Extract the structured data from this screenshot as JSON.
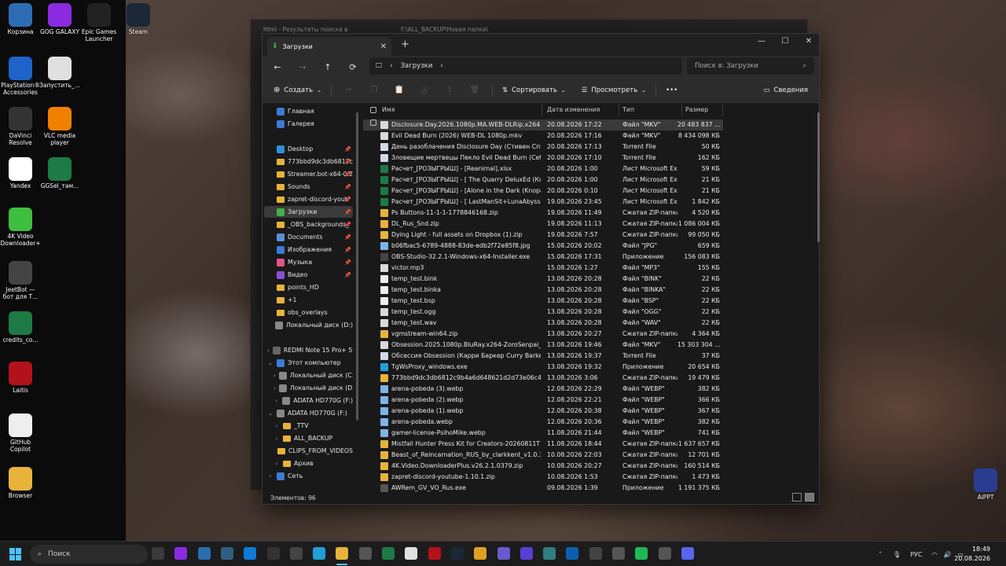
{
  "desktop_icons": [
    {
      "label": "Корзина",
      "icon": "recycle-bin-icon",
      "color": "#2d6db5"
    },
    {
      "label": "GOG GALAXY",
      "icon": "gog-galaxy-icon",
      "color": "#8a2be2"
    },
    {
      "label": "Epic Games Launcher",
      "icon": "epic-games-icon",
      "color": "#222222"
    },
    {
      "label": "Steam",
      "icon": "steam-icon",
      "color": "#1b2838"
    },
    {
      "label": "PlayStation® Accessories",
      "icon": "playstation-icon",
      "color": "#1e63c9"
    },
    {
      "label": "Запустить_...",
      "icon": "launch-icon",
      "color": "#e0e0e0"
    },
    {
      "label": "DaVinci Resolve",
      "icon": "davinci-icon",
      "color": "#333333"
    },
    {
      "label": "VLC media player",
      "icon": "vlc-icon",
      "color": "#f08000"
    },
    {
      "label": "Yandex",
      "icon": "yandex-icon",
      "color": "#ffffff"
    },
    {
      "label": "GGSel_там...",
      "icon": "excel-file-icon",
      "color": "#1d7a45"
    },
    {
      "label": "4K Video Downloader+",
      "icon": "4k-downloader-icon",
      "color": "#3fbf3f"
    },
    {
      "label": "JeetBot — бот для Т...",
      "icon": "jeetbot-icon",
      "color": "#444444"
    },
    {
      "label": "credits_co...",
      "icon": "excel-file-icon",
      "color": "#1d7a45"
    },
    {
      "label": "Laitis",
      "icon": "laitis-icon",
      "color": "#b3121c"
    },
    {
      "label": "GitHub Copilot",
      "icon": "github-copilot-icon",
      "color": "#eeeeee"
    },
    {
      "label": "Browser",
      "icon": "browser-folder-icon",
      "color": "#e8b33a"
    },
    {
      "label": "AiPPT",
      "icon": "aippt-icon",
      "color": "#2a3c90"
    }
  ],
  "background_window": {
    "tab1": "html - Результаты поиска в",
    "tab2": "F:\\ALL_BACKUP\\Новая папка\\"
  },
  "window": {
    "tab_title": "Загрузки",
    "address": "Загрузки",
    "search_placeholder": "Поиск в: Загрузки",
    "toolbar": {
      "create": "Создать",
      "sort": "Сортировать",
      "view": "Просмотреть",
      "more": "•••",
      "details": "Сведения"
    },
    "columns": {
      "name": "Имя",
      "date": "Дата изменения",
      "type": "Тип",
      "size": "Размер"
    },
    "status": "Элементов: 96",
    "nav": [
      {
        "label": "Главная",
        "icon": "home-icon",
        "indent": 0,
        "chev": "",
        "pin": false
      },
      {
        "label": "Галерея",
        "icon": "gallery-icon",
        "indent": 0,
        "chev": "",
        "pin": false
      },
      {
        "label": "Desktop",
        "icon": "desktop-icon",
        "indent": 0,
        "chev": "",
        "pin": true
      },
      {
        "label": "773bbd9dc3db6812c",
        "icon": "folder-icon",
        "indent": 0,
        "chev": "",
        "pin": true
      },
      {
        "label": "Streamer.bot-x64-0.2",
        "icon": "folder-icon",
        "indent": 0,
        "chev": "",
        "pin": true
      },
      {
        "label": "Sounds",
        "icon": "folder-icon",
        "indent": 0,
        "chev": "",
        "pin": true
      },
      {
        "label": "zapret-discord-yout",
        "icon": "folder-icon",
        "indent": 0,
        "chev": "",
        "pin": true
      },
      {
        "label": "Загрузки",
        "icon": "downloads-icon",
        "indent": 0,
        "chev": "",
        "pin": true,
        "selected": true
      },
      {
        "label": "_OBS_backgrounds_",
        "icon": "folder-icon",
        "indent": 0,
        "chev": "",
        "pin": true
      },
      {
        "label": "Documents",
        "icon": "documents-icon",
        "indent": 0,
        "chev": "",
        "pin": true
      },
      {
        "label": "Изображения",
        "icon": "pictures-icon",
        "indent": 0,
        "chev": "",
        "pin": true
      },
      {
        "label": "Музыка",
        "icon": "music-icon",
        "indent": 0,
        "chev": "",
        "pin": true
      },
      {
        "label": "Видео",
        "icon": "video-icon",
        "indent": 0,
        "chev": "",
        "pin": true
      },
      {
        "label": "points_HD",
        "icon": "folder-icon",
        "indent": 0,
        "chev": "",
        "pin": false
      },
      {
        "label": "+1",
        "icon": "folder-icon",
        "indent": 0,
        "chev": "",
        "pin": false
      },
      {
        "label": "obs_overlays",
        "icon": "folder-icon",
        "indent": 0,
        "chev": "",
        "pin": false
      },
      {
        "label": "Локальный диск (D:)",
        "icon": "drive-icon",
        "indent": 0,
        "chev": "",
        "pin": false
      },
      {
        "label": "REDMI Note 15 Pro+ 5G",
        "icon": "phone-icon",
        "indent": 0,
        "chev": "›",
        "pin": false
      },
      {
        "label": "Этот компьютер",
        "icon": "computer-icon",
        "indent": 0,
        "chev": "⌄",
        "pin": false
      },
      {
        "label": "Локальный диск (C:)",
        "icon": "drive-icon",
        "indent": 1,
        "chev": "›",
        "pin": false
      },
      {
        "label": "Локальный диск (D:)",
        "icon": "drive-icon",
        "indent": 1,
        "chev": "›",
        "pin": false
      },
      {
        "label": "ADATA HD770G (F:)",
        "icon": "drive-icon",
        "indent": 1,
        "chev": "›",
        "pin": false
      },
      {
        "label": "ADATA HD770G (F:)",
        "icon": "drive-icon",
        "indent": 0,
        "chev": "⌄",
        "pin": false
      },
      {
        "label": "_TTV",
        "icon": "folder-icon",
        "indent": 1,
        "chev": "›",
        "pin": false
      },
      {
        "label": "ALL_BACKUP",
        "icon": "folder-icon",
        "indent": 1,
        "chev": "›",
        "pin": false
      },
      {
        "label": "CLIPS_FROM_VIDEOS",
        "icon": "folder-icon",
        "indent": 1,
        "chev": "",
        "pin": false
      },
      {
        "label": "Архив",
        "icon": "folder-icon",
        "indent": 1,
        "chev": "›",
        "pin": false
      },
      {
        "label": "Сеть",
        "icon": "network-icon",
        "indent": 0,
        "chev": "›",
        "pin": false
      }
    ],
    "files": [
      {
        "name": "Disclosure.Day.2026.1080p.MA.WEB-DLRip.x264-HiD...",
        "date": "20.08.2026 17:22",
        "type": "Файл \"MKV\"",
        "size": "20 483 837 ...",
        "icon": "video-file-icon",
        "selected": true
      },
      {
        "name": "Evil Dead Burn (2026) WEB-DL 1080p.mkv",
        "date": "20.08.2026 17:16",
        "type": "Файл \"MKV\"",
        "size": "8 434 098 КБ",
        "icon": "video-file-icon"
      },
      {
        "name": "День разоблачения Disclosure Day (Стивен Спилб...",
        "date": "20.08.2026 17:13",
        "type": "Torrent File",
        "size": "50 КБ",
        "icon": "torrent-file-icon"
      },
      {
        "name": "Зловещие мертвецы Пекло Evil Dead Burn (Себас...",
        "date": "20.08.2026 17:10",
        "type": "Torrent File",
        "size": "162 КБ",
        "icon": "torrent-file-icon"
      },
      {
        "name": "Расчет_[РОЗЫГРЫШ] - [Reanimal].xlsx",
        "date": "20.08.2026 1:00",
        "type": "Лист Microsoft Ex...",
        "size": "59 КБ",
        "icon": "excel-file-icon"
      },
      {
        "name": "Расчет_[РОЗЫГРЫШ] - [ The Quarry DeluxEd (Кнор...",
        "date": "20.08.2026 1:00",
        "type": "Лист Microsoft Ex...",
        "size": "21 КБ",
        "icon": "excel-file-icon"
      },
      {
        "name": "Расчет_[РОЗЫГРЫШ] - [Alone in the Dark (KnopaFil...",
        "date": "20.08.2026 0:10",
        "type": "Лист Microsoft Ex...",
        "size": "21 КБ",
        "icon": "excel-file-icon"
      },
      {
        "name": "Расчет_[РОЗЫГРЫШ] - [ LastManSit+LunaAbyss+C...",
        "date": "19.08.2026 23:45",
        "type": "Лист Microsoft Ex...",
        "size": "1 842 КБ",
        "icon": "excel-file-icon"
      },
      {
        "name": "Ps Buttons-11-1-1-1778846168.zip",
        "date": "19.08.2026 11:49",
        "type": "Сжатая ZIP-папка",
        "size": "4 520 КБ",
        "icon": "zip-folder-icon"
      },
      {
        "name": "DL_Rus_Snd.zip",
        "date": "19.08.2026 11:13",
        "type": "Сжатая ZIP-папка",
        "size": "1 086 004 КБ",
        "icon": "zip-folder-icon"
      },
      {
        "name": "Dying Light - full assets on Dropbox (1).zip",
        "date": "19.08.2026 7:57",
        "type": "Сжатая ZIP-папка",
        "size": "99 050 КБ",
        "icon": "zip-folder-icon"
      },
      {
        "name": "b06fbac5-6789-4888-83de-edb2f72e85f8.jpg",
        "date": "15.08.2026 20:02",
        "type": "Файл \"JPG\"",
        "size": "659 КБ",
        "icon": "image-file-icon"
      },
      {
        "name": "OBS-Studio-32.2.1-Windows-x64-Installer.exe",
        "date": "15.08.2026 17:31",
        "type": "Приложение",
        "size": "156 083 КБ",
        "icon": "obs-app-icon"
      },
      {
        "name": "victor.mp3",
        "date": "15.08.2026 1:27",
        "type": "Файл \"MP3\"",
        "size": "155 КБ",
        "icon": "audio-file-icon"
      },
      {
        "name": "temp_test.bink",
        "date": "13.08.2026 20:28",
        "type": "Файл \"BINK\"",
        "size": "22 КБ",
        "icon": "generic-file-icon"
      },
      {
        "name": "temp_test.binka",
        "date": "13.08.2026 20:28",
        "type": "Файл \"BINKA\"",
        "size": "22 КБ",
        "icon": "generic-file-icon"
      },
      {
        "name": "temp_test.bsp",
        "date": "13.08.2026 20:28",
        "type": "Файл \"BSP\"",
        "size": "22 КБ",
        "icon": "generic-file-icon"
      },
      {
        "name": "temp_test.ogg",
        "date": "13.08.2026 20:28",
        "type": "Файл \"OGG\"",
        "size": "22 КБ",
        "icon": "audio-file-icon"
      },
      {
        "name": "temp_test.wav",
        "date": "13.08.2026 20:28",
        "type": "Файл \"WAV\"",
        "size": "22 КБ",
        "icon": "audio-file-icon"
      },
      {
        "name": "vgmstream-win64.zip",
        "date": "13.08.2026 20:27",
        "type": "Сжатая ZIP-папка",
        "size": "4 364 КБ",
        "icon": "zip-folder-icon"
      },
      {
        "name": "Obsession.2025.1080p.BluRay.x264-ZoroSenpai_Enia...",
        "date": "13.08.2026 19:46",
        "type": "Файл \"MKV\"",
        "size": "15 303 304 ...",
        "icon": "video-file-icon"
      },
      {
        "name": "Обсессия Obsession (Карри Баркер Curry Barker) [...",
        "date": "13.08.2026 19:37",
        "type": "Torrent File",
        "size": "37 КБ",
        "icon": "torrent-file-icon"
      },
      {
        "name": "TgWsProxy_windows.exe",
        "date": "13.08.2026 19:32",
        "type": "Приложение",
        "size": "20 654 КБ",
        "icon": "telegram-app-icon"
      },
      {
        "name": "773bbd9dc3db6812c9b4a6d648621d2d73e06c4d.zip",
        "date": "13.08.2026 3:06",
        "type": "Сжатая ZIP-папка",
        "size": "19 479 КБ",
        "icon": "zip-folder-icon"
      },
      {
        "name": "arena-pobeda (3).webp",
        "date": "12.08.2026 22:29",
        "type": "Файл \"WEBP\"",
        "size": "382 КБ",
        "icon": "image-file-icon"
      },
      {
        "name": "arena-pobeda (2).webp",
        "date": "12.08.2026 22:21",
        "type": "Файл \"WEBP\"",
        "size": "366 КБ",
        "icon": "image-file-icon"
      },
      {
        "name": "arena-pobeda (1).webp",
        "date": "12.08.2026 20:38",
        "type": "Файл \"WEBP\"",
        "size": "367 КБ",
        "icon": "image-file-icon"
      },
      {
        "name": "arena-pobeda.webp",
        "date": "12.08.2026 20:36",
        "type": "Файл \"WEBP\"",
        "size": "382 КБ",
        "icon": "image-file-icon"
      },
      {
        "name": "gamer-license-PsihoMike.webp",
        "date": "11.08.2026 21:44",
        "type": "Файл \"WEBP\"",
        "size": "741 КБ",
        "icon": "image-file-icon"
      },
      {
        "name": "Mistfall Hunter Press Kit for Creators-20260811T154...",
        "date": "11.08.2026 18:44",
        "type": "Сжатая ZIP-папка",
        "size": "1 637 657 КБ",
        "icon": "zip-folder-icon"
      },
      {
        "name": "Beast_of_Reincarnation_RUS_by_clarkkent_v1.0.3.zip",
        "date": "10.08.2026 22:03",
        "type": "Сжатая ZIP-папка",
        "size": "12 701 КБ",
        "icon": "zip-folder-icon"
      },
      {
        "name": "4K.Video.DownloaderPlus.v26.2.1.0379.zip",
        "date": "10.08.2026 20:27",
        "type": "Сжатая ZIP-папка",
        "size": "160 514 КБ",
        "icon": "zip-folder-icon"
      },
      {
        "name": "zapret-discord-youtube-1.10.1.zip",
        "date": "10.08.2026 1:53",
        "type": "Сжатая ZIP-папка",
        "size": "1 473 КБ",
        "icon": "zip-folder-icon"
      },
      {
        "name": "AWRem_GV_VO_Rus.exe",
        "date": "09.08.2026 1:39",
        "type": "Приложение",
        "size": "1 191 375 КБ",
        "icon": "app-icon"
      }
    ]
  },
  "taskbar": {
    "search_placeholder": "Поиск",
    "language": "РУС",
    "time": "18:49",
    "date": "20.08.2026",
    "apps": [
      {
        "icon": "task-view-icon",
        "color": "#3a3a3a"
      },
      {
        "icon": "gog-galaxy-icon",
        "color": "#8a2be2"
      },
      {
        "icon": "store-icon",
        "color": "#2b6cb0"
      },
      {
        "icon": "app-icon",
        "color": "#2f5f7f"
      },
      {
        "icon": "edge-icon",
        "color": "#0f7bd6"
      },
      {
        "icon": "app-icon",
        "color": "#333333"
      },
      {
        "icon": "app-icon",
        "color": "#444444"
      },
      {
        "icon": "telegram-icon",
        "color": "#229ed9"
      },
      {
        "icon": "explorer-icon",
        "color": "#e8b33a"
      },
      {
        "icon": "settings-icon",
        "color": "#555555"
      },
      {
        "icon": "excel-icon",
        "color": "#1d7a45"
      },
      {
        "icon": "yandex-icon",
        "color": "#e0e0e0"
      },
      {
        "icon": "app-icon",
        "color": "#b3121c"
      },
      {
        "icon": "steam-icon",
        "color": "#1b2838"
      },
      {
        "icon": "chrome-icon",
        "color": "#e0a020"
      },
      {
        "icon": "app-icon",
        "color": "#6a5acd"
      },
      {
        "icon": "app-icon",
        "color": "#5a3fd6"
      },
      {
        "icon": "app-icon",
        "color": "#2f7f7f"
      },
      {
        "icon": "vscode-icon",
        "color": "#0a5fb0"
      },
      {
        "icon": "app-icon",
        "color": "#444444"
      },
      {
        "icon": "app-icon",
        "color": "#555555"
      },
      {
        "icon": "spotify-icon",
        "color": "#1db954"
      },
      {
        "icon": "app-icon",
        "color": "#555555"
      },
      {
        "icon": "discord-icon",
        "color": "#5865f2"
      }
    ]
  }
}
